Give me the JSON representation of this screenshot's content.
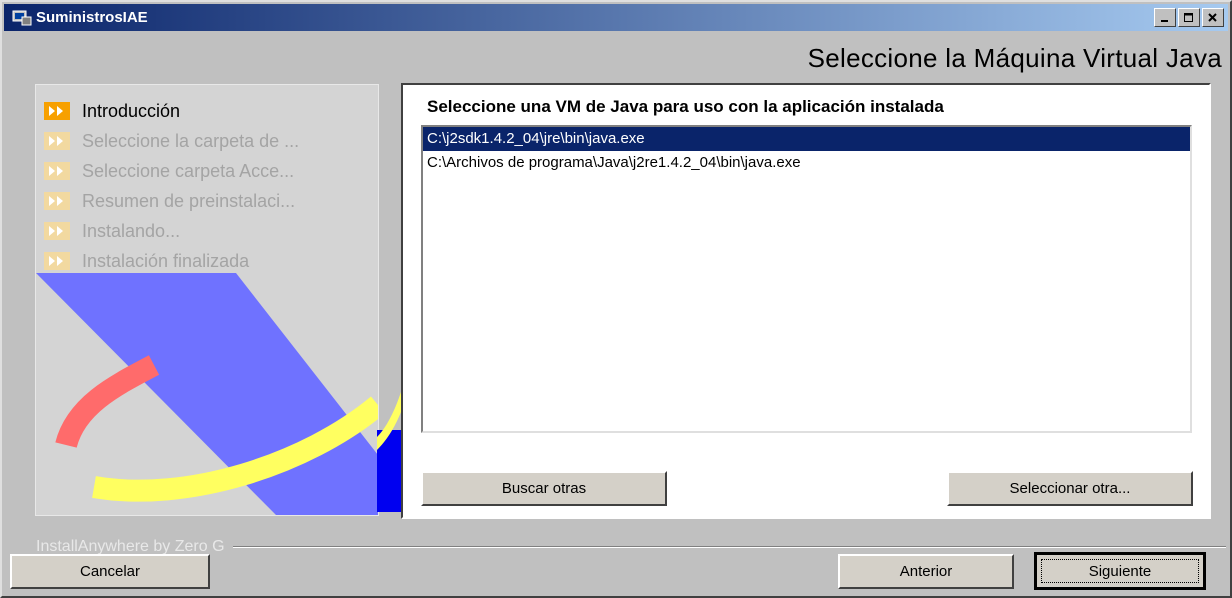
{
  "window": {
    "title": "SuministrosIAE"
  },
  "title_buttons": {
    "minimize": "_",
    "maximize": "□",
    "close": "×"
  },
  "header": {
    "title": "Seleccione la Máquina Virtual Java"
  },
  "steps": [
    {
      "label": "Introducción",
      "state": "active"
    },
    {
      "label": "Seleccione la carpeta de ...",
      "state": "inactive"
    },
    {
      "label": "Seleccione carpeta Acce...",
      "state": "inactive"
    },
    {
      "label": "Resumen de preinstalaci...",
      "state": "inactive"
    },
    {
      "label": "Instalando...",
      "state": "inactive"
    },
    {
      "label": "Instalación finalizada",
      "state": "inactive"
    }
  ],
  "main": {
    "title": "Seleccione una VM de Java para uso con la aplicación instalada",
    "vms": [
      {
        "path": "C:\\j2sdk1.4.2_04\\jre\\bin\\java.exe",
        "selected": true
      },
      {
        "path": "C:\\Archivos de programa\\Java\\j2re1.4.2_04\\bin\\java.exe",
        "selected": false
      }
    ],
    "search_button": "Buscar otras",
    "select_button": "Seleccionar otra..."
  },
  "footer": {
    "brand": "InstallAnywhere by Zero G",
    "cancel_button": "Cancelar",
    "previous_button": "Anterior",
    "next_button": "Siguiente"
  },
  "colors": {
    "title_bar": "#0a246a",
    "selection": "#0a246a",
    "step_icon_active": "#f7a000",
    "step_icon_inactive": "#f2d9a0",
    "logo_blue": "#6f72ff",
    "logo_yellow": "#ffff60",
    "logo_red": "#ff6b6b"
  }
}
